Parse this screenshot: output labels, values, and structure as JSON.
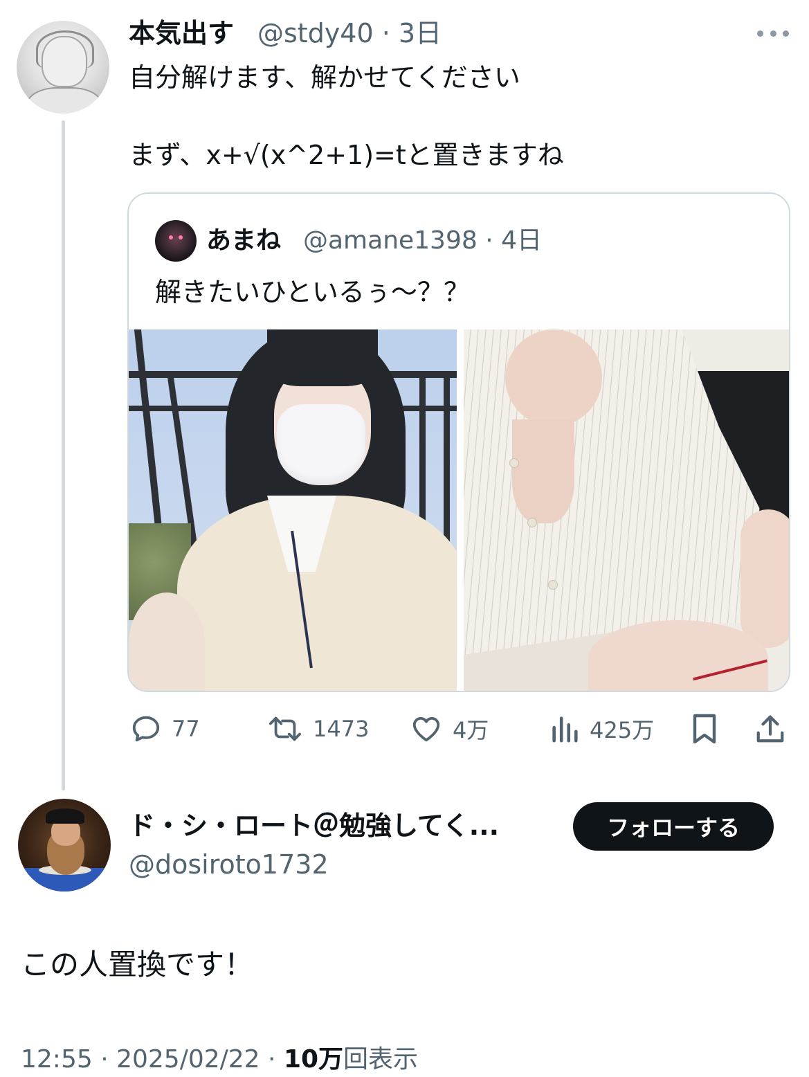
{
  "thread_tweet": {
    "display_name": "本気出す",
    "handle": "@stdy40",
    "separator": " · ",
    "time_ago": "3日",
    "text": "自分解けます、解かせてください\n\nまず、x+√(x^2+1)=tと置きますね"
  },
  "quoted_tweet": {
    "display_name": "あまね",
    "handle": "@amane1398",
    "separator": " · ",
    "time_ago": "4日",
    "text": "解きたいひといるぅ〜？？"
  },
  "actions": {
    "replies": "77",
    "retweets": "1473",
    "likes": "4万",
    "views": "425万"
  },
  "main_tweet": {
    "display_name": "ド・シ・ロート＠勉強してく...",
    "handle": "@dosiroto1732",
    "follow_label": "フォローする",
    "text": "この人置換です！",
    "time": "12:55",
    "date": "2025/02/22",
    "separator": " · ",
    "view_count": "10万",
    "view_suffix": "回表示"
  },
  "colors": {
    "text": "#0f1419",
    "muted": "#536471",
    "border": "#cfd9de",
    "follow_button_bg": "#0f1419"
  },
  "icons": [
    "more-icon",
    "reply-icon",
    "retweet-icon",
    "like-icon",
    "views-icon",
    "bookmark-icon",
    "share-icon"
  ]
}
